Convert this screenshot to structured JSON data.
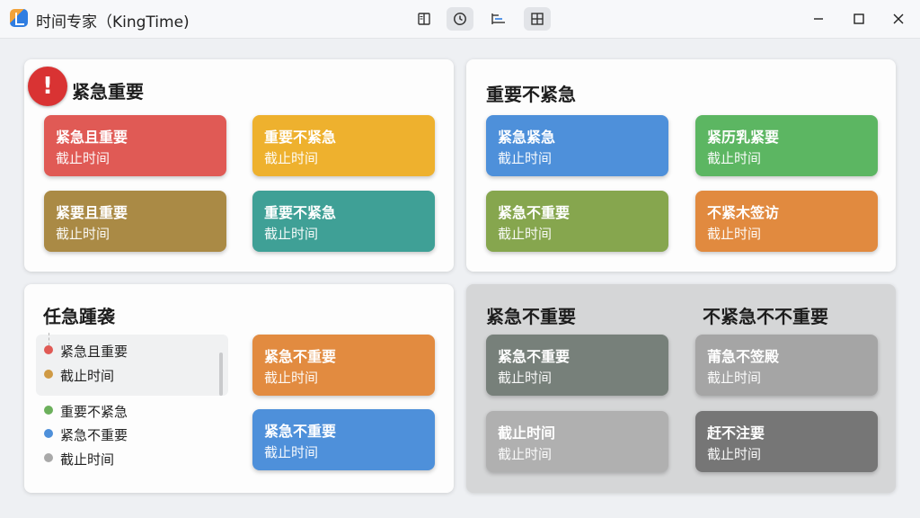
{
  "app": {
    "title": "时间专家（KingTime)"
  },
  "toolbar": {
    "icons": [
      "book-icon",
      "clock-icon",
      "timeline-icon",
      "grid-icon"
    ]
  },
  "quadrants": {
    "q1": {
      "title": "紧急重要",
      "badge": "!",
      "cards": [
        {
          "title": "紧急且重要",
          "sub": "截止时间",
          "color": "#e05a55"
        },
        {
          "title": "重要不紧急",
          "sub": "截止时间",
          "color": "#eeb12e"
        },
        {
          "title": "紧要且重要",
          "sub": "截止时间",
          "color": "#aa8a45"
        },
        {
          "title": "重要不紧急",
          "sub": "截止时间",
          "color": "#3fa096"
        }
      ]
    },
    "q2": {
      "title": "重要不紧急",
      "cards": [
        {
          "title": "紧急紧急",
          "sub": "截止时间",
          "color": "#4e90da"
        },
        {
          "title": "紧历乳紧要",
          "sub": "截止时间",
          "color": "#5cb662"
        },
        {
          "title": "紧急不重要",
          "sub": "截止时间",
          "color": "#86a64e"
        },
        {
          "title": "不紧木签访",
          "sub": "截止时间",
          "color": "#e18a3f"
        }
      ]
    },
    "q3": {
      "title": "任急踵袭",
      "legend": [
        {
          "label": "紧急且重要",
          "color": "#e05a55"
        },
        {
          "label": "截止时间",
          "color": "#cf9a45"
        },
        {
          "label": "重要不紧急",
          "color": "#6cb05c"
        },
        {
          "label": "紧急不重要",
          "color": "#4e90da"
        },
        {
          "label": "截止时间",
          "color": "#a9a9a9"
        }
      ],
      "cards": [
        {
          "title": "紧急不重要",
          "sub": "截止时间",
          "color": "#e28b40"
        },
        {
          "title": "紧急不重要",
          "sub": "截止时间",
          "color": "#4e90da"
        }
      ]
    },
    "q4": {
      "title_left": "紧急不重要",
      "title_right": "不紧急不不重要",
      "cards": [
        {
          "title": "紧急不重要",
          "sub": "截止时间",
          "color": "#77807a"
        },
        {
          "title": "莆急不签殿",
          "sub": "截止时间",
          "color": "#a5a5a5"
        },
        {
          "title": "截止时间",
          "sub": "截止时间",
          "color": "#b0b0b0"
        },
        {
          "title": "赶不注要",
          "sub": "截止时间",
          "color": "#767676"
        }
      ]
    }
  }
}
